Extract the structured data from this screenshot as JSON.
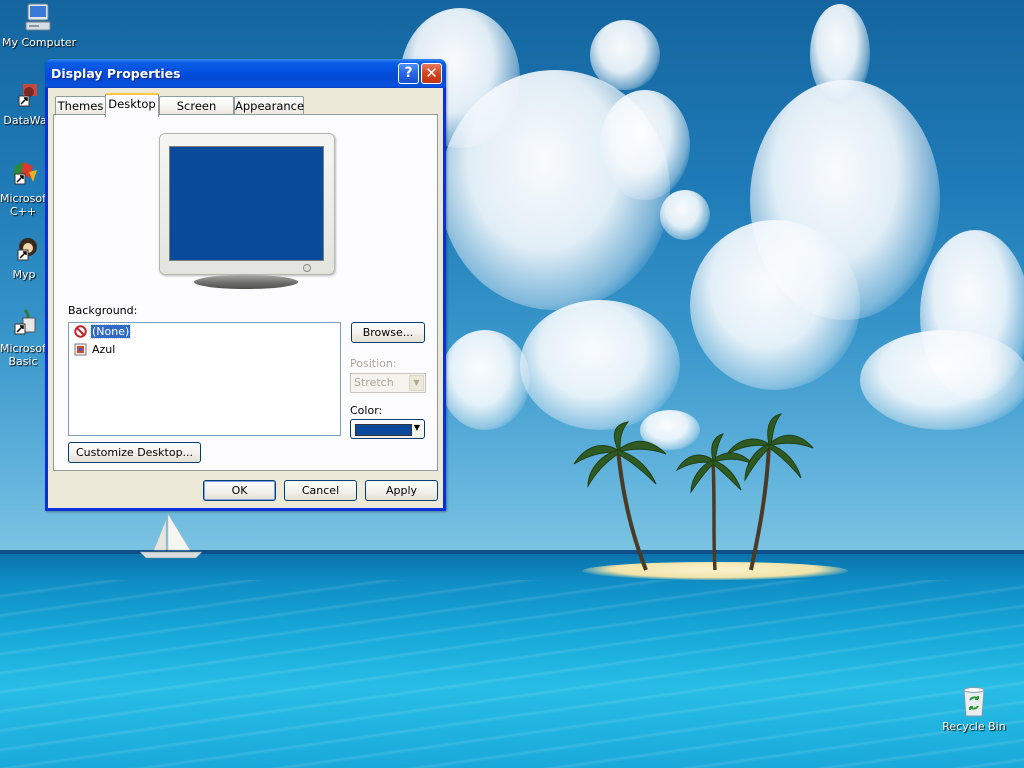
{
  "desktop": {
    "icons": [
      {
        "label": "My Computer"
      },
      {
        "label": "DataWa"
      },
      {
        "label": "Microsoft\nC++"
      },
      {
        "label": "Myp"
      },
      {
        "label": "Microsoft\nBasic"
      },
      {
        "label": "Recycle Bin"
      }
    ]
  },
  "window": {
    "title": "Display Properties",
    "help_glyph": "?",
    "close_glyph": "✕",
    "tabs": [
      {
        "label": "Themes",
        "active": false
      },
      {
        "label": "Desktop",
        "active": true
      },
      {
        "label": "Screen Saver",
        "active": false
      },
      {
        "label": "Appearance",
        "active": false
      }
    ],
    "preview_color": "#0A4A9B",
    "background_label": "Background:",
    "background_items": [
      {
        "label": "(None)",
        "icon": "none-icon",
        "selected": true
      },
      {
        "label": "Azul",
        "icon": "bitmap-icon",
        "selected": false
      }
    ],
    "browse_label": "Browse...",
    "position_label": "Position:",
    "position_value": "Stretch",
    "color_label": "Color:",
    "color_value": "#0A4A9B",
    "customize_label": "Customize Desktop...",
    "ok_label": "OK",
    "cancel_label": "Cancel",
    "apply_label": "Apply"
  }
}
